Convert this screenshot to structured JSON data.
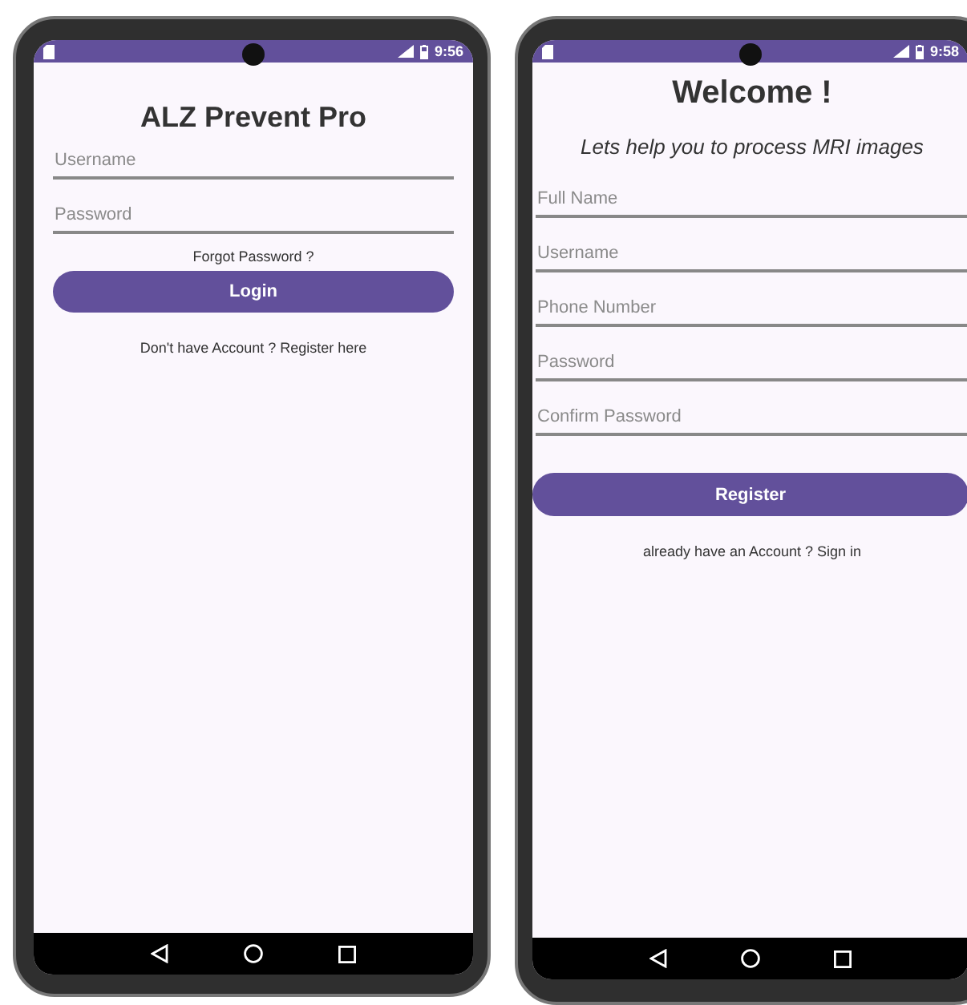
{
  "phones": [
    {
      "status_bar": {
        "time": "9:56"
      },
      "screen": {
        "kind": "login",
        "items": [
          {
            "kind": "title",
            "text": "ALZ Prevent Pro"
          },
          {
            "kind": "field",
            "placeholder": "Username"
          },
          {
            "kind": "field",
            "placeholder": "Password"
          },
          {
            "kind": "link",
            "text": "Forgot Password ?"
          },
          {
            "kind": "button",
            "text": "Login"
          },
          {
            "kind": "footer",
            "text": "Don't have Account ? Register here"
          }
        ]
      }
    },
    {
      "status_bar": {
        "time": "9:58"
      },
      "screen": {
        "kind": "register",
        "items": [
          {
            "kind": "title",
            "text": "Welcome !"
          },
          {
            "kind": "subtitle",
            "text": "Lets help you to process MRI images"
          },
          {
            "kind": "field",
            "placeholder": "Full Name"
          },
          {
            "kind": "field",
            "placeholder": "Username"
          },
          {
            "kind": "field",
            "placeholder": "Phone Number"
          },
          {
            "kind": "field",
            "placeholder": "Password"
          },
          {
            "kind": "field",
            "placeholder": "Confirm Password"
          },
          {
            "kind": "button",
            "text": "Register"
          },
          {
            "kind": "footer",
            "text": "already have an Account ? Sign in"
          }
        ]
      }
    }
  ]
}
